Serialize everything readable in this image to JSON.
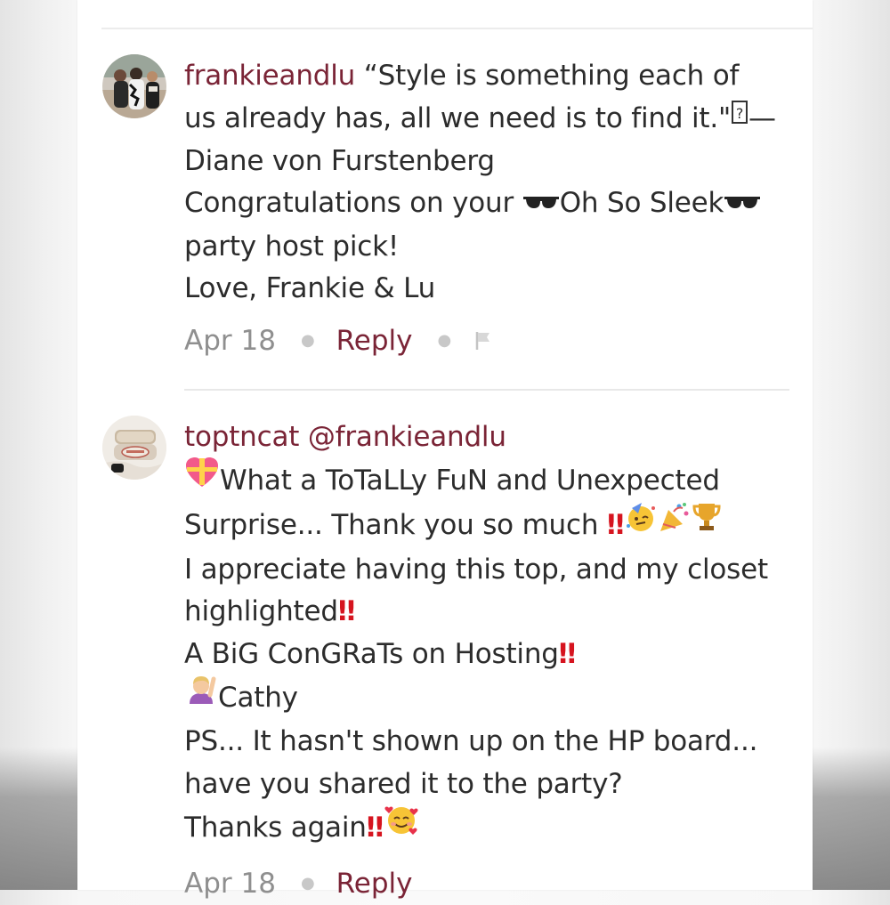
{
  "comments": [
    {
      "username": "frankieandlu",
      "lines": [
        "“Style is something each of",
        "us already has, all we need is to find it.\"",
        "—",
        "Diane von Furstenberg",
        "Congratulations on your ",
        "Oh So Sleek",
        "party host pick!",
        "Love, Frankie & Lu"
      ],
      "date": "Apr 18",
      "reply_label": "Reply"
    },
    {
      "username": "toptncat",
      "mention": "@frankieandlu",
      "lines": [
        "What a ToTaLLy FuN and Unexpected",
        "Surprise... Thank you so much ",
        "I appreciate having this top, and my closet",
        "highlighted",
        "A BiG ConGRaTs on Hosting",
        "Cathy",
        "PS... It hasn't shown up on the HP board...",
        "have you shared it to the party?",
        "Thanks again"
      ],
      "date": "Apr 18",
      "reply_label": "Reply"
    }
  ],
  "icons": {
    "sunglasses": "sunglasses-icon",
    "gift_heart": "gift-heart-icon",
    "double_exclamation": "‼",
    "party_face": "partying-face-icon",
    "party_popper": "party-popper-icon",
    "trophy": "trophy-icon",
    "raising_hand": "person-raising-hand-icon",
    "smiling_hearts": "smiling-face-with-hearts-icon",
    "flag": "flag-icon",
    "missing_glyph": "missing-glyph-icon"
  },
  "colors": {
    "username": "#7a2436",
    "text": "#2c2c2c",
    "date": "#8f8f8f",
    "exclamation": "#d6141f"
  }
}
